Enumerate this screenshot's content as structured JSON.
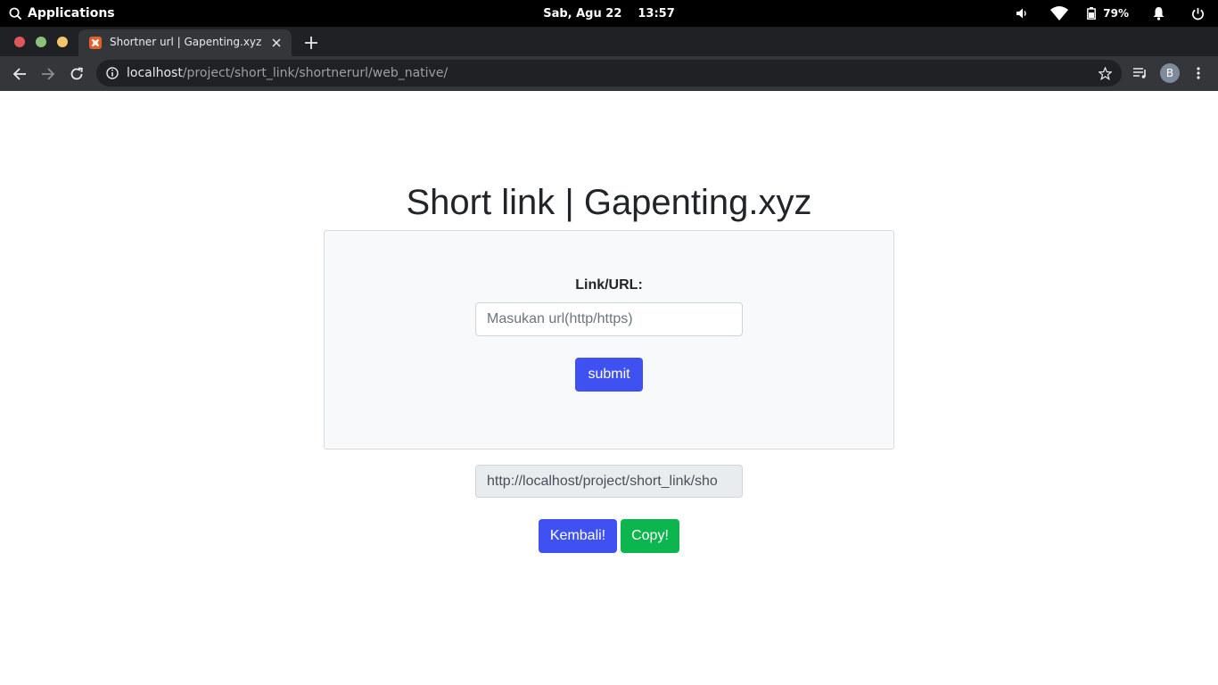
{
  "system_bar": {
    "apps_label": "Applications",
    "date": "Sab, Agu 22",
    "time": "13:57",
    "battery_percent": "79%",
    "icons": [
      "search-icon",
      "volume-icon",
      "wifi-icon",
      "battery-icon",
      "bell-icon",
      "power-icon"
    ]
  },
  "browser": {
    "window_controls": {
      "close_color": "#e0575b",
      "minimize_color": "#8ec07c",
      "maximize_color": "#f2c66d"
    },
    "tab": {
      "title": "Shortner url | Gapenting.xyz",
      "favicon": "xampp-icon"
    },
    "address_bar": {
      "host": "localhost",
      "path": "/project/short_link/shortnerurl/web_native/"
    },
    "profile_initial": "B"
  },
  "page": {
    "title": "Short link | Gapenting.xyz",
    "form": {
      "label": "Link/URL:",
      "input_placeholder": "Masukan url(http/https)",
      "input_value": "",
      "submit_label": "submit"
    },
    "result": {
      "value": "http://localhost/project/short_link/sho"
    },
    "back_label": "Kembali!",
    "copy_label": "Copy!"
  },
  "colors": {
    "primary": "#4051f2",
    "success": "#0cb54d",
    "text": "#212529"
  }
}
